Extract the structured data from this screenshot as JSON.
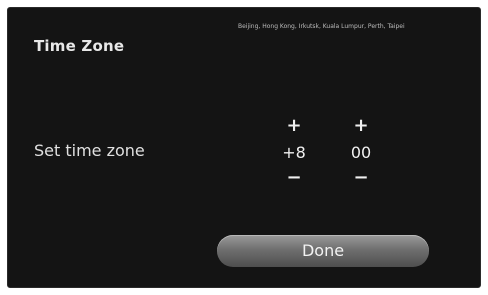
{
  "header": {
    "title": "Time Zone",
    "cities": "Beijing, Hong Kong, Irkutsk, Kuala Lumpur, Perth, Taipei"
  },
  "timezone": {
    "label": "Set time zone",
    "hours": {
      "increment": "+",
      "value": "+8",
      "decrement": "−"
    },
    "minutes": {
      "increment": "+",
      "value": "00",
      "decrement": "−"
    }
  },
  "actions": {
    "done_label": "Done"
  }
}
